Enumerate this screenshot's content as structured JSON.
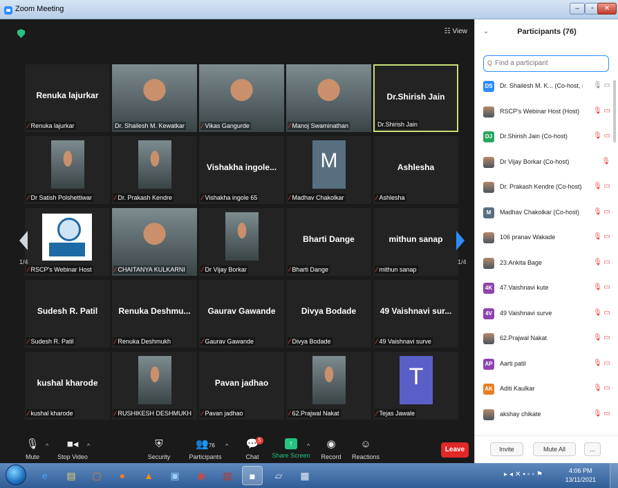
{
  "window": {
    "title": "Zoom Meeting"
  },
  "stage": {
    "view_label": "View",
    "page_left": "1/4",
    "page_right": "1/4"
  },
  "tiles": [
    {
      "big": "Renuka lajurkar",
      "label": "Renuka lajurkar",
      "muted": true,
      "photo": "none"
    },
    {
      "big": "",
      "label": "Dr. Shailesh M. Kewatkar",
      "muted": false,
      "photo": "person"
    },
    {
      "big": "",
      "label": "Vikas Gangurde",
      "muted": true,
      "photo": "person"
    },
    {
      "big": "",
      "label": "Manoj Swaminathan",
      "muted": true,
      "photo": "person"
    },
    {
      "big": "Dr.Shirish Jain",
      "label": "Dr.Shirish Jain",
      "muted": false,
      "photo": "none",
      "active": true
    },
    {
      "big": "",
      "label": "Dr Satish Polshettiwar",
      "muted": true,
      "photo": "person-sm"
    },
    {
      "big": "",
      "label": "Dr. Prakash Kendre",
      "muted": true,
      "photo": "person-sm"
    },
    {
      "big": "Vishakha ingole...",
      "label": "Vishakha ingole 65",
      "muted": true,
      "photo": "none"
    },
    {
      "big": "",
      "label": "Madhav Chakolkar",
      "muted": true,
      "photo": "letter",
      "letter": "M"
    },
    {
      "big": "Ashlesha",
      "label": "Ashlesha",
      "muted": true,
      "photo": "none"
    },
    {
      "big": "",
      "label": "RSCP's Webinar Host",
      "muted": true,
      "photo": "logo"
    },
    {
      "big": "",
      "label": "CHAITANYA KULKARNI",
      "muted": true,
      "photo": "person"
    },
    {
      "big": "",
      "label": "Dr Vijay Borkar",
      "muted": true,
      "photo": "person-sm"
    },
    {
      "big": "Bharti Dange",
      "label": "Bharti Dange",
      "muted": true,
      "photo": "none"
    },
    {
      "big": "mithun sanap",
      "label": "mithun sanap",
      "muted": true,
      "photo": "none"
    },
    {
      "big": "Sudesh R. Patil",
      "label": "Sudesh R. Patil",
      "muted": true,
      "photo": "none"
    },
    {
      "big": "Renuka  Deshmu...",
      "label": "Renuka Deshmukh",
      "muted": true,
      "photo": "none"
    },
    {
      "big": "Gaurav Gawande",
      "label": "Gaurav Gawande",
      "muted": true,
      "photo": "none"
    },
    {
      "big": "Divya Bodade",
      "label": "Divya Bodade",
      "muted": true,
      "photo": "none"
    },
    {
      "big": "49 Vaishnavi sur...",
      "label": "49 Vaishnavi surve",
      "muted": true,
      "photo": "none"
    },
    {
      "big": "kushal kharode",
      "label": "kushal kharode",
      "muted": true,
      "photo": "none"
    },
    {
      "big": "",
      "label": "RUSHIKESH DESHMUKH",
      "muted": true,
      "photo": "person-sm"
    },
    {
      "big": "Pavan jadhao",
      "label": "Pavan jadhao",
      "muted": true,
      "photo": "none"
    },
    {
      "big": "",
      "label": "62.Prajwal Nakat",
      "muted": true,
      "photo": "person-sm"
    },
    {
      "big": "",
      "label": "Tejas Jawale",
      "muted": true,
      "photo": "letterT",
      "letter": "T"
    }
  ],
  "toolbar": {
    "mute": "Mute",
    "stop_video": "Stop Video",
    "security": "Security",
    "participants": "Participants",
    "participants_count": "76",
    "chat": "Chat",
    "chat_badge": "5",
    "share_screen": "Share Screen",
    "record": "Record",
    "reactions": "Reactions",
    "leave": "Leave"
  },
  "panel": {
    "title": "Participants (76)",
    "search_placeholder": "Find a participant",
    "invite": "Invite",
    "mute_all": "Mute All",
    "more": "...",
    "participants": [
      {
        "initials": "DS",
        "color": "#2d8cff",
        "name": "Dr. Shailesh M. K...  (Co-host, me)",
        "icons": "🎙 ▭",
        "gray": true
      },
      {
        "initials": "",
        "color": "",
        "name": "RSCP's Webinar Host (Host)",
        "icons": "🎙 ▭",
        "gray": false
      },
      {
        "initials": "DJ",
        "color": "#26a65b",
        "name": "Dr.Shirish Jain (Co-host)",
        "icons": "🎙 ▭",
        "gray": false
      },
      {
        "initials": "",
        "color": "",
        "name": "Dr Vijay Borkar (Co-host)",
        "icons": "🎙",
        "gray": false
      },
      {
        "initials": "",
        "color": "",
        "name": "Dr. Prakash Kendre (Co-host)",
        "icons": "🎙 ▭",
        "gray": false
      },
      {
        "initials": "M",
        "color": "#586f80",
        "name": "Madhav Chakolkar (Co-host)",
        "icons": "🎙 ▭",
        "gray": false
      },
      {
        "initials": "",
        "color": "",
        "name": "106 pranav Wakade",
        "icons": "🎙 ▭",
        "gray": false
      },
      {
        "initials": "",
        "color": "",
        "name": "23.Ankita Bage",
        "icons": "🎙 ▭",
        "gray": false
      },
      {
        "initials": "4K",
        "color": "#8e44ad",
        "name": "47.Vaishnavi kute",
        "icons": "🎙 ▭",
        "gray": false
      },
      {
        "initials": "4V",
        "color": "#8e44ad",
        "name": "49 Vaishnavi surve",
        "icons": "🎙 ▭",
        "gray": false
      },
      {
        "initials": "",
        "color": "",
        "name": "62.Prajwal Nakat",
        "icons": "🎙 ▭",
        "gray": false
      },
      {
        "initials": "AP",
        "color": "#8e44ad",
        "name": "Aarti patil",
        "icons": "🎙 ▭",
        "gray": false
      },
      {
        "initials": "AK",
        "color": "#e67e22",
        "name": "Aditi Kaulkar",
        "icons": "🎙 ▭",
        "gray": false
      },
      {
        "initials": "",
        "color": "",
        "name": "akshay chikate",
        "icons": "🎙 ▭",
        "gray": false
      }
    ]
  },
  "taskbar": {
    "time": "4:06 PM",
    "date": "13/11/2021"
  }
}
